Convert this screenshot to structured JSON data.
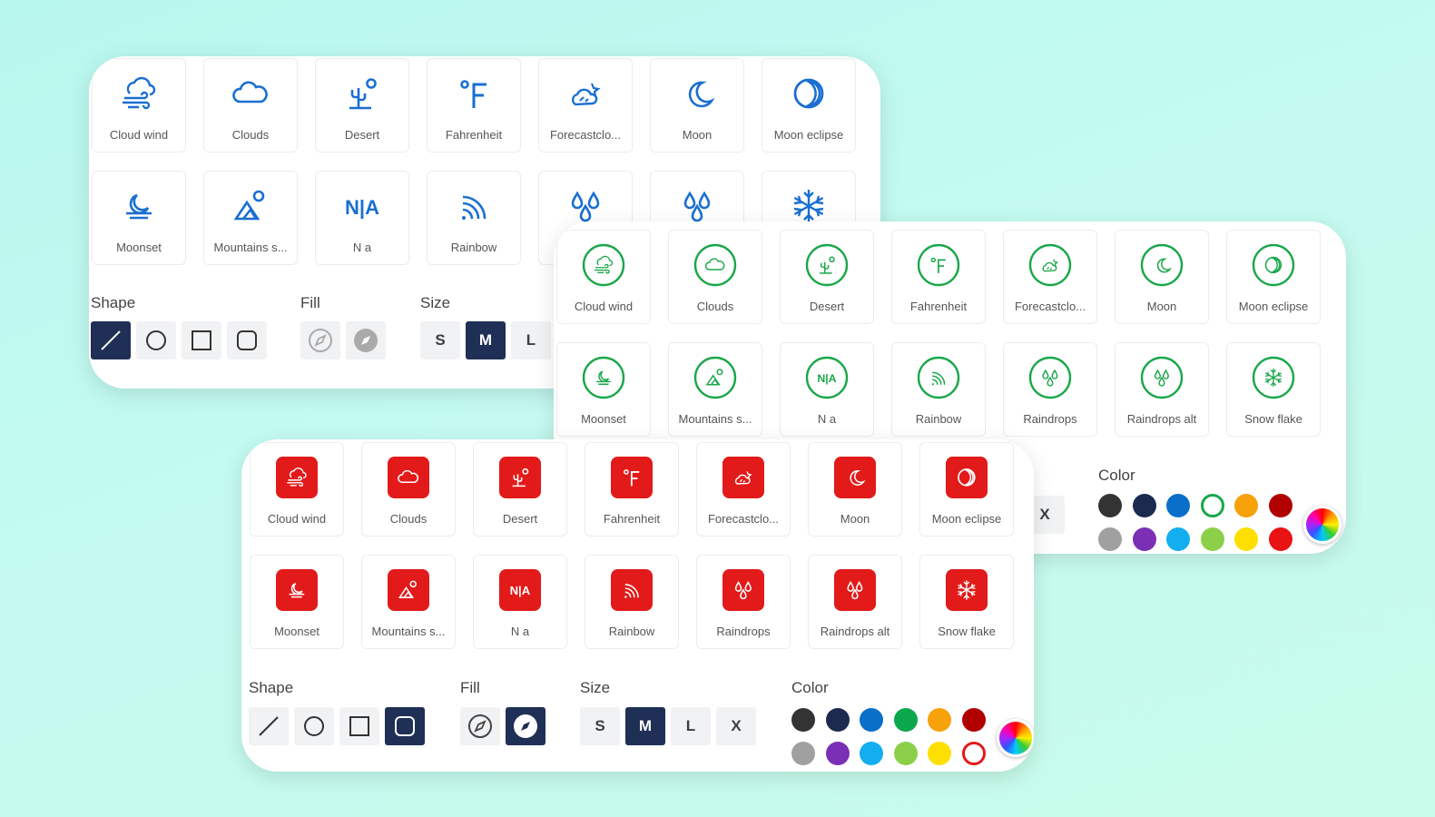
{
  "colors": {
    "blue": "#1a6fd1",
    "green": "#1aa74a",
    "red": "#e21a1a",
    "navy": "#1f2f55"
  },
  "tiles": [
    {
      "label": "Cloud wind",
      "icon": "cloud-wind-icon"
    },
    {
      "label": "Clouds",
      "icon": "clouds-icon"
    },
    {
      "label": "Desert",
      "icon": "desert-icon"
    },
    {
      "label": "Fahrenheit",
      "icon": "fahrenheit-icon"
    },
    {
      "label": "Forecastclo...",
      "icon": "forecast-cloud-icon"
    },
    {
      "label": "Moon",
      "icon": "moon-icon"
    },
    {
      "label": "Moon eclipse",
      "icon": "moon-eclipse-icon"
    },
    {
      "label": "Moonset",
      "icon": "moonset-icon"
    },
    {
      "label": "Mountains s...",
      "icon": "mountains-sun-icon"
    },
    {
      "label": "N a",
      "icon": "na-icon"
    },
    {
      "label": "Rainbow",
      "icon": "rainbow-icon"
    },
    {
      "label": "Raindrops",
      "icon": "raindrops-icon"
    },
    {
      "label": "Raindrops alt",
      "icon": "raindrops-alt-icon"
    },
    {
      "label": "Snow flake",
      "icon": "snowflake-icon"
    }
  ],
  "controls": {
    "shape_label": "Shape",
    "fill_label": "Fill",
    "size_label": "Size",
    "color_label": "Color",
    "sizes": [
      "S",
      "M",
      "L",
      "X"
    ],
    "selected_size": "M"
  },
  "palette": [
    "#333333",
    "#1b2a4e",
    "#0a6fc9",
    "#0aa84a",
    "#f7a10b",
    "#b00000",
    "#a0a0a0",
    "#7a2fb5",
    "#12aef0",
    "#8cd04a",
    "#ffdf00",
    "#e81313"
  ]
}
